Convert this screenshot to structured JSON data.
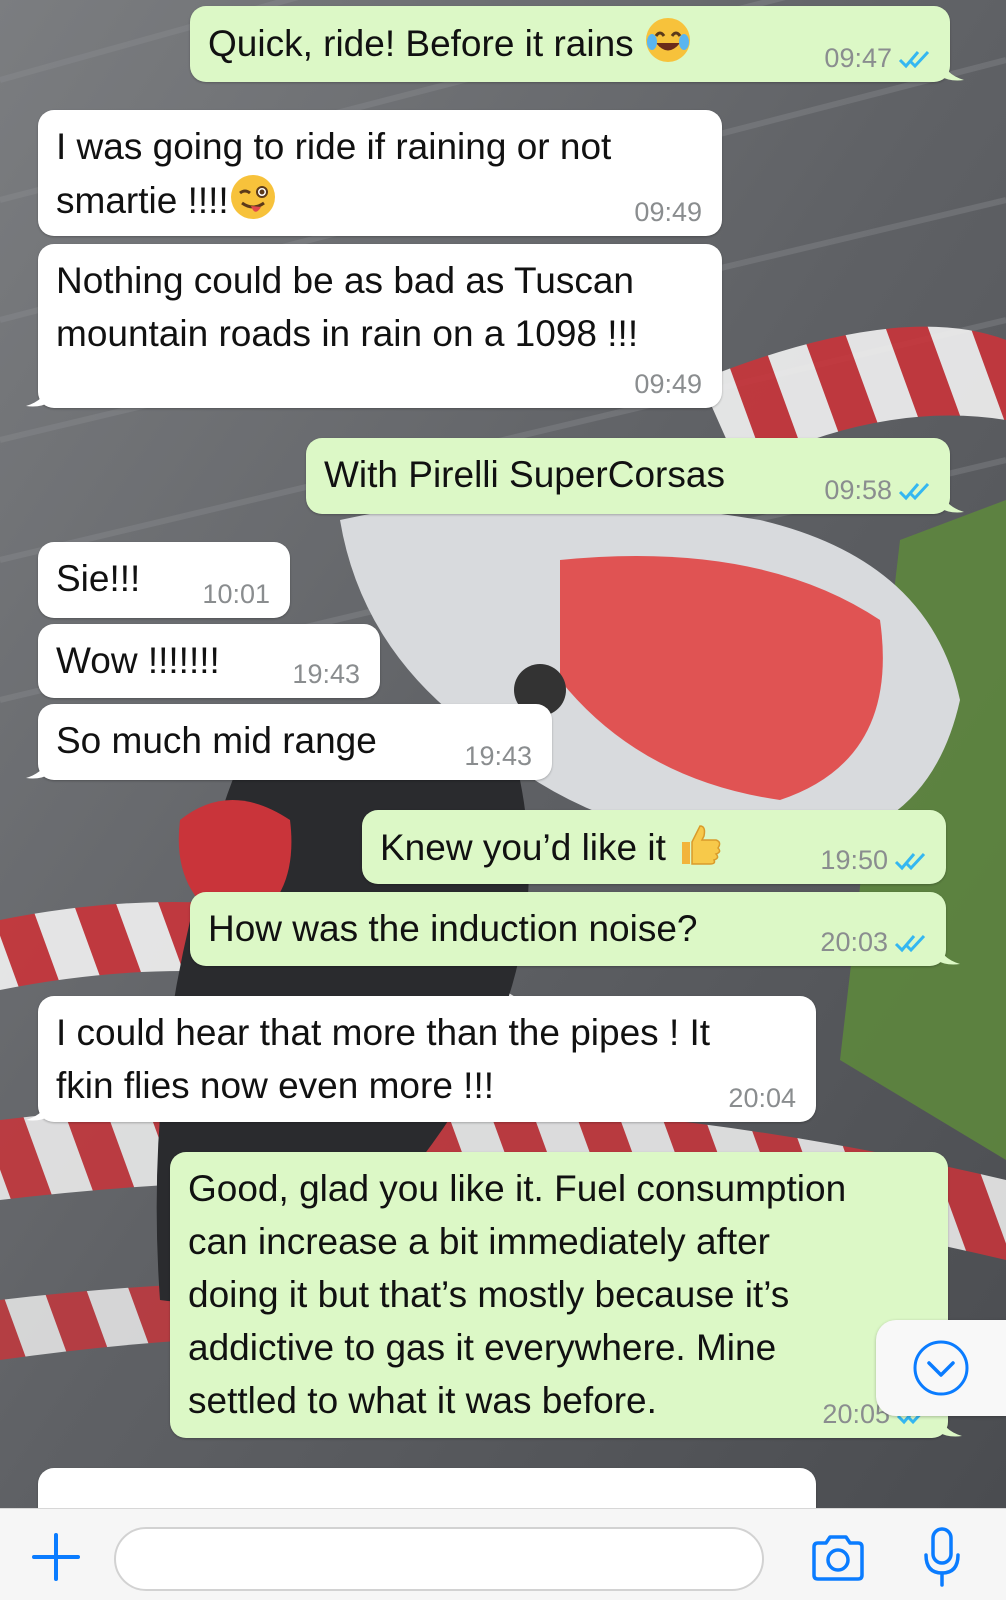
{
  "messages": [
    {
      "id": "m1",
      "direction": "out",
      "text": "Quick, ride! Before it rains",
      "emoji": "face-with-tears-of-joy",
      "time": "09:47",
      "status": "read"
    },
    {
      "id": "m2",
      "direction": "in",
      "text": "I was going to ride if raining or not\nsmartie !!!!",
      "emoji": "winking-face-with-tongue",
      "time": "09:49"
    },
    {
      "id": "m3",
      "direction": "in",
      "text": "Nothing could be as bad as Tuscan\nmountain roads in rain on a 1098 !!!",
      "time": "09:49"
    },
    {
      "id": "m4",
      "direction": "out",
      "text": "With Pirelli SuperCorsas",
      "time": "09:58",
      "status": "read"
    },
    {
      "id": "m5",
      "direction": "in",
      "text": "Sie!!!",
      "time": "10:01"
    },
    {
      "id": "m6",
      "direction": "in",
      "text": "Wow !!!!!!!",
      "time": "19:43"
    },
    {
      "id": "m7",
      "direction": "in",
      "text": "So much mid range",
      "time": "19:43"
    },
    {
      "id": "m8",
      "direction": "out",
      "text": "Knew you’d like it",
      "emoji": "thumbs-up",
      "time": "19:50",
      "status": "read"
    },
    {
      "id": "m9",
      "direction": "out",
      "text": "How was the induction noise?",
      "time": "20:03",
      "status": "read"
    },
    {
      "id": "m10",
      "direction": "in",
      "text": "I could hear that more than the pipes ! It\nfkin flies now even more !!!",
      "time": "20:04"
    },
    {
      "id": "m11",
      "direction": "out",
      "text": "Good, glad you like it. Fuel consumption\ncan increase a bit immediately after\ndoing it but that’s mostly because it’s\naddictive to gas it everywhere. Mine\nsettled to what it was before.",
      "time": "20:05",
      "status": "read"
    }
  ],
  "composer": {
    "input_value": "",
    "placeholder": "",
    "icons": [
      "plus-icon",
      "camera-icon",
      "microphone-icon"
    ]
  },
  "scroll_button_icon": "chevron-down-circle-icon",
  "colors": {
    "incoming_bubble": "#ffffff",
    "outgoing_bubble": "#dcf8c6",
    "read_tick": "#34b7f1",
    "accent": "#0a7cff",
    "timestamp": "#8a8d8f"
  }
}
